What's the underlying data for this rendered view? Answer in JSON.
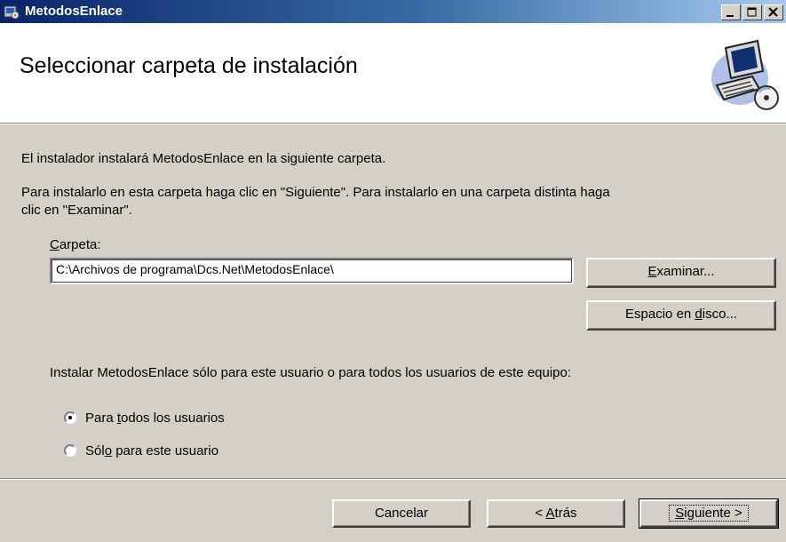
{
  "window": {
    "title": "MetodosEnlace",
    "controls": [
      "minimize-icon",
      "maximize-icon",
      "close-icon"
    ]
  },
  "header": {
    "heading": "Seleccionar carpeta de instalación",
    "banner_icon": "computer-cd-icon"
  },
  "body": {
    "intro": "El instalador instalará MetodosEnlace en la siguiente carpeta.",
    "instructions_line1": "Para instalarlo en esta carpeta haga clic en \"Siguiente\". Para instalarlo en una carpeta distinta haga",
    "instructions_line2": "clic en \"Examinar\".",
    "folder_label_key": "C",
    "folder_label_rest": "arpeta:",
    "folder_value": "C:\\Archivos de programa\\Dcs.Net\\MetodosEnlace\\",
    "browse_key": "E",
    "browse_rest": "xaminar...",
    "disk_pre": "Espacio en ",
    "disk_key": "d",
    "disk_post": "isco...",
    "scope_question": "Instalar MetodosEnlace sólo para este usuario o para todos los usuarios de este equipo:",
    "radio_all_pre": "Para ",
    "radio_all_key": "t",
    "radio_all_post": "odos los usuarios",
    "radio_all_checked": true,
    "radio_me_pre": "Sól",
    "radio_me_key": "o",
    "radio_me_post": " para este usuario",
    "radio_me_checked": false
  },
  "footer": {
    "cancel": "Cancelar",
    "back_pre": "< ",
    "back_key": "A",
    "back_post": "trás",
    "next_key": "S",
    "next_post": "iguiente >"
  }
}
